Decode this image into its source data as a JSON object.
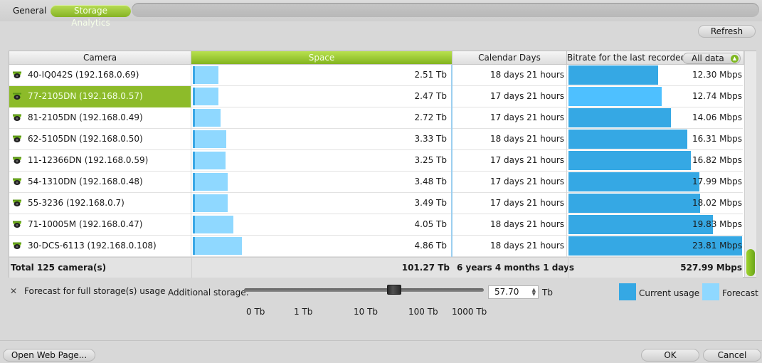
{
  "tabs": [
    {
      "label": "General",
      "active": false
    },
    {
      "label": "Storage Analytics",
      "active": true
    }
  ],
  "refresh_label": "Refresh",
  "columns": {
    "camera": "Camera",
    "space": "Space",
    "calendar_days": "Calendar Days",
    "bitrate": "Bitrate for the last recorded:",
    "bitrate_filter": "All data"
  },
  "rows": [
    {
      "camera": "40-IQ042S (192.168.0.69)",
      "space": "2.51 Tb",
      "space_fill": 0.025,
      "days": "18 days 21 hours",
      "bitrate": "12.30 Mbps",
      "bitrate_fill": 0.516,
      "selected": false
    },
    {
      "camera": "77-2105DN (192.168.0.57)",
      "space": "2.47 Tb",
      "space_fill": 0.025,
      "days": "17 days 21 hours",
      "bitrate": "12.74 Mbps",
      "bitrate_fill": 0.535,
      "selected": true
    },
    {
      "camera": "81-2105DN (192.168.0.49)",
      "space": "2.72 Tb",
      "space_fill": 0.027,
      "days": "17 days 21 hours",
      "bitrate": "14.06 Mbps",
      "bitrate_fill": 0.59,
      "selected": false
    },
    {
      "camera": "62-5105DN (192.168.0.50)",
      "space": "3.33 Tb",
      "space_fill": 0.033,
      "days": "18 days 21 hours",
      "bitrate": "16.31 Mbps",
      "bitrate_fill": 0.685,
      "selected": false
    },
    {
      "camera": "11-12366DN (192.168.0.59)",
      "space": "3.25 Tb",
      "space_fill": 0.032,
      "days": "17 days 21 hours",
      "bitrate": "16.82 Mbps",
      "bitrate_fill": 0.706,
      "selected": false
    },
    {
      "camera": "54-1310DN (192.168.0.48)",
      "space": "3.48 Tb",
      "space_fill": 0.034,
      "days": "17 days 21 hours",
      "bitrate": "17.99 Mbps",
      "bitrate_fill": 0.755,
      "selected": false
    },
    {
      "camera": "55-3236 (192.168.0.7)",
      "space": "3.49 Tb",
      "space_fill": 0.034,
      "days": "17 days 21 hours",
      "bitrate": "18.02 Mbps",
      "bitrate_fill": 0.757,
      "selected": false
    },
    {
      "camera": "71-10005M (192.168.0.47)",
      "space": "4.05 Tb",
      "space_fill": 0.04,
      "days": "18 days 21 hours",
      "bitrate": "19.83 Mbps",
      "bitrate_fill": 0.833,
      "selected": false
    },
    {
      "camera": "30-DCS-6113 (192.168.0.108)",
      "space": "4.86 Tb",
      "space_fill": 0.048,
      "days": "18 days 21 hours",
      "bitrate": "23.81 Mbps",
      "bitrate_fill": 1.0,
      "selected": false
    }
  ],
  "totals": {
    "cameras": "Total 125 camera(s)",
    "space": "101.27 Tb",
    "days": "6 years 4 months 1 days",
    "bitrate": "527.99 Mbps"
  },
  "forecast_label": "Forecast for full storage(s) usage",
  "forecast_checked": true,
  "additional_storage_label": "Additional storage:",
  "additional_storage_value": "57.70",
  "slider_ticks": [
    "0 Tb",
    "1 Tb",
    "10 Tb",
    "100 Tb",
    "1000 Tb"
  ],
  "unit_label": "Tb",
  "legend": {
    "current": "Current usage",
    "forecast": "Forecast"
  },
  "colors": {
    "accent_green": "#8dbb2a",
    "current_usage": "#35a8e4",
    "forecast": "#8fd8ff",
    "selected_bitrate": "#4ec0ff"
  },
  "footer": {
    "open_web_page": "Open Web Page...",
    "ok": "OK",
    "cancel": "Cancel"
  }
}
